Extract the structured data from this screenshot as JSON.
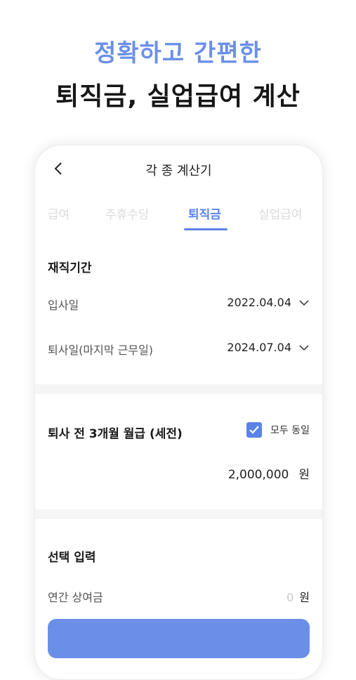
{
  "hero": {
    "headline": "정확하고 간편한",
    "subheadline": "퇴직금, 실업급여 계산"
  },
  "appbar": {
    "title": "각 종 계산기"
  },
  "tabs": [
    {
      "label": "급여",
      "active": false
    },
    {
      "label": "주휴수당",
      "active": false
    },
    {
      "label": "퇴직금",
      "active": true
    },
    {
      "label": "실업급여",
      "active": false
    }
  ],
  "employment": {
    "title": "재직기간",
    "start_label": "입사일",
    "start_value": "2022.04.04",
    "end_label": "퇴사일(마지막 근무일)",
    "end_value": "2024.07.04"
  },
  "salary": {
    "title": "퇴사 전 3개월 월급 (세전)",
    "same_label": "모두 동일",
    "same_checked": true,
    "amount": "2,000,000",
    "unit": "원"
  },
  "optional": {
    "title": "선택 입력",
    "bonus_label": "연간 상여금",
    "bonus_value": "0",
    "bonus_unit": "원"
  },
  "colors": {
    "accent": "#5a83e8",
    "hero_blue": "#6b8fe8"
  }
}
